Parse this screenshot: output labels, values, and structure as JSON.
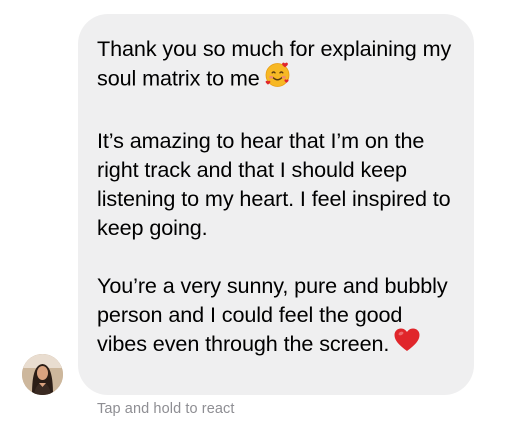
{
  "message": {
    "paragraph_1": "Thank you so much for explaining my soul matrix to me",
    "paragraph_1_emoji": "smiling-face-with-hearts-icon",
    "paragraph_2": "It’s amazing to hear that I’m on the right track and that I should keep listening to my heart. I feel inspired to keep going.",
    "paragraph_3": "You’re a very sunny, pure and bubbly person and I could feel the good vibes even through the screen.",
    "paragraph_3_emoji": "red-heart-icon"
  },
  "hint": {
    "text": "Tap and hold to react"
  },
  "colors": {
    "bubble": "#efeff0",
    "text": "#000000",
    "hint": "#8e8e93",
    "heart": "#e0262b",
    "emoji_face": "#f7b824"
  }
}
